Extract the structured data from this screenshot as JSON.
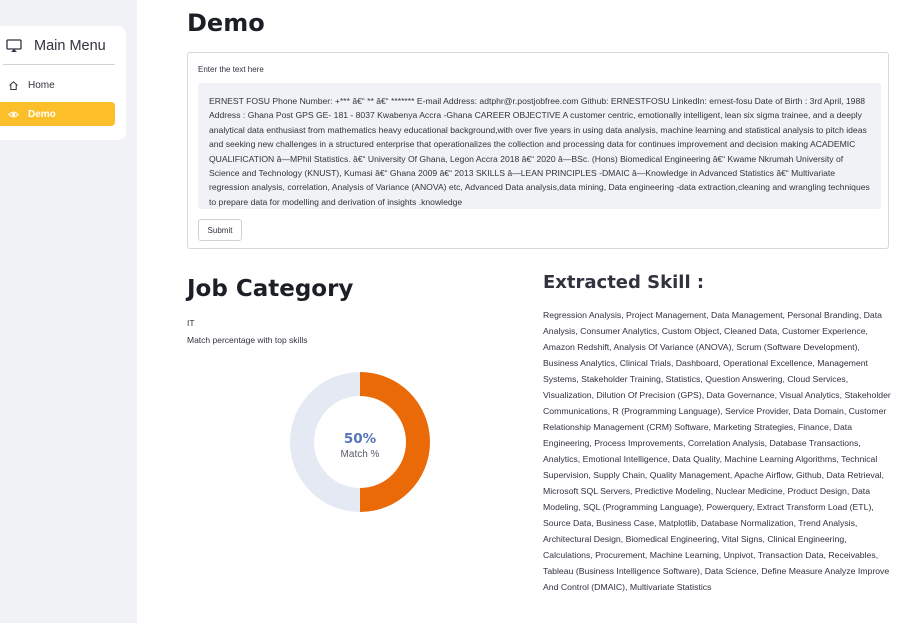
{
  "sidebar": {
    "menu_title": "Main Menu",
    "menu_icon": "cast-icon",
    "items": [
      {
        "label": "Home",
        "icon": "house-icon",
        "selected": false
      },
      {
        "label": "Demo",
        "icon": "eye-icon",
        "selected": true
      }
    ],
    "accent_color": "#fcbf29"
  },
  "main": {
    "title": "Demo",
    "input_label": "Enter the text here",
    "input_value": "ERNEST FOSU  Phone Number: +*** â€“ ** â€“ ******* E-mail Address: adtphr@r.postjobfree.com Github: ERNESTFOSU LinkedIn: ernest-fosu Date of Birth : 3rd April, 1988 Address : Ghana Post GPS GE- 181 - 8037 Kwabenya Accra -Ghana CAREER OBJECTIVE  A customer centric, emotionally intelligent, lean six sigma trainee, and a deeply analytical data enthusiast from mathematics heavy educational background,with over five years in using data analysis, machine learning and statistical analysis to pitch ideas and seeking new challenges in a structured enterprise that operationalizes the collection and processing data for continues improvement and decision making ACADEMIC QUALIFICATION  â—MPhil Statistics. â€“ University Of Ghana, Legon Accra 2018 â€“ 2020 â—BSc. (Hons) Biomedical Engineering â€“ Kwame Nkrumah University of Science and Technology (KNUST), Kumasi â€“ Ghana 2009 â€“ 2013 SKILLS  â—LEAN PRINCIPLES -DMAIC â—Knowledge in Advanced Statistics â€“ Multivariate regression analysis, correlation, Analysis of Variance (ANOVA) etc, Advanced Data analysis,data mining, Data engineering -data extraction,cleaning and wrangling techniques to prepare data for modelling and derivation of insights .knowledge",
    "submit_label": "Submit"
  },
  "job": {
    "heading": "Job Category",
    "value": "IT",
    "caption": "Match percentage with top skills"
  },
  "donut": {
    "match_fraction": 0.5,
    "percent_label": "50%",
    "sub_label": "Match %",
    "fill_color": "#eb6a08",
    "track_color": "#e4e9f4",
    "label_color": "#5576b8"
  },
  "skills": {
    "heading": "Extracted Skill :",
    "text": "Regression Analysis, Project Management, Data Management, Personal Branding, Data Analysis, Consumer Analytics, Custom Object, Cleaned Data, Customer Experience, Amazon Redshift, Analysis Of Variance (ANOVA), Scrum (Software Development), Business Analytics, Clinical Trials, Dashboard, Operational Excellence, Management Systems, Stakeholder Training, Statistics, Question Answering, Cloud Services, Visualization, Dilution Of Precision (GPS), Data Governance, Visual Analytics, Stakeholder Communications, R (Programming Language), Service Provider, Data Domain, Customer Relationship Management (CRM) Software, Marketing Strategies, Finance, Data Engineering, Process Improvements, Correlation Analysis, Database Transactions, Analytics, Emotional Intelligence, Data Quality, Machine Learning Algorithms, Technical Supervision, Supply Chain, Quality Management, Apache Airflow, Github, Data Retrieval, Microsoft SQL Servers, Predictive Modeling, Nuclear Medicine, Product Design, Data Modeling, SQL (Programming Language), Powerquery, Extract Transform Load (ETL), Source Data, Business Case, Matplotlib, Database Normalization, Trend Analysis, Architectural Design, Biomedical Engineering, Vital Signs, Clinical Engineering, Calculations, Procurement, Machine Learning, Unpivot, Transaction Data, Receivables, Tableau (Business Intelligence Software), Data Science, Define Measure Analyze Improve And Control (DMAIC), Multivariate Statistics"
  }
}
